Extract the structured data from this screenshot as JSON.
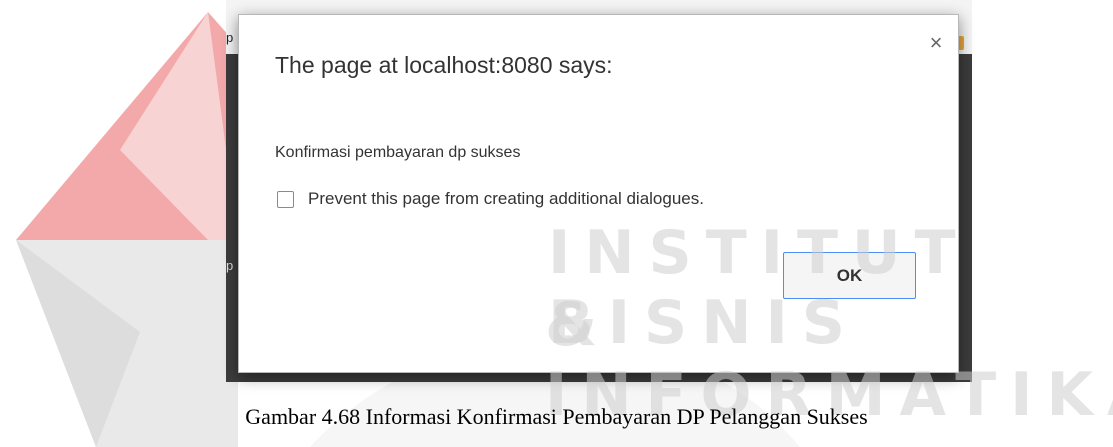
{
  "dialog": {
    "title": "The page at localhost:8080 says:",
    "message": "Konfirmasi pembayaran dp sukses",
    "prevent_label": "Prevent this page from creating additional dialogues.",
    "ok_label": "OK",
    "close_symbol": "×",
    "prevent_checked": false
  },
  "background_fragments": [
    "p",
    "p"
  ],
  "watermark": {
    "line1": "INSTITUT BISNIS",
    "line2": "& INFORMATIKA"
  },
  "caption": "Gambar 4.68 Informasi Konfirmasi Pembayaran DP Pelanggan Sukses",
  "colors": {
    "logo_red": "#f3a9a9",
    "logo_pink": "#f8d3d3",
    "logo_grey": "#e7e7e7",
    "ok_border": "#4c8ef5"
  }
}
